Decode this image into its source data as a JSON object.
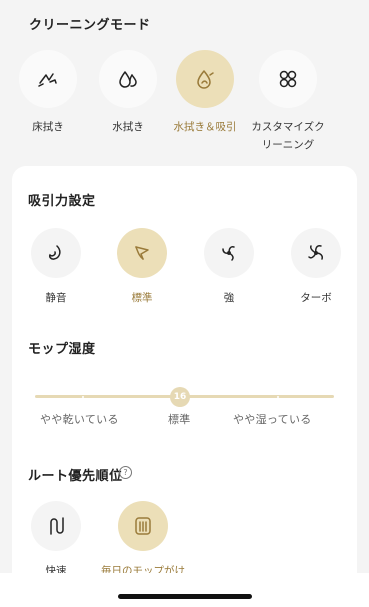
{
  "cleaning_mode": {
    "title": "クリーニングモード",
    "items": [
      {
        "label": "床拭き",
        "icon": "floor-wipe-icon",
        "selected": false
      },
      {
        "label": "水拭き",
        "icon": "water-drops-icon",
        "selected": false
      },
      {
        "label": "水拭き＆吸引",
        "icon": "wipe-and-suction-icon",
        "selected": true
      },
      {
        "label": "カスタマイズクリーニング",
        "label_line1": "カスタマイズク",
        "label_line2": "リーニング",
        "icon": "custom-clover-icon",
        "selected": false
      }
    ]
  },
  "suction": {
    "title": "吸引力設定",
    "items": [
      {
        "label": "静音",
        "icon": "quiet-fan-icon",
        "selected": false
      },
      {
        "label": "標準",
        "icon": "standard-fan-icon",
        "selected": true
      },
      {
        "label": "強",
        "icon": "strong-fan-icon",
        "selected": false
      },
      {
        "label": "ターボ",
        "icon": "turbo-fan-icon",
        "selected": false
      }
    ]
  },
  "mop_humidity": {
    "title": "モップ湿度",
    "value": "16",
    "labels": [
      "やや乾いている",
      "標準",
      "やや湿っている"
    ]
  },
  "route_priority": {
    "title": "ルート優先順位",
    "help_icon": "?",
    "items": [
      {
        "label": "快速",
        "icon": "fast-route-icon",
        "selected": false
      },
      {
        "label": "毎日のモップがけ",
        "icon": "daily-mop-route-icon",
        "selected": true
      }
    ]
  },
  "colors": {
    "accent": "#ecdfb8",
    "accent_text": "#9a7b3a",
    "background": "#f4f4f4",
    "card": "#ffffff"
  }
}
